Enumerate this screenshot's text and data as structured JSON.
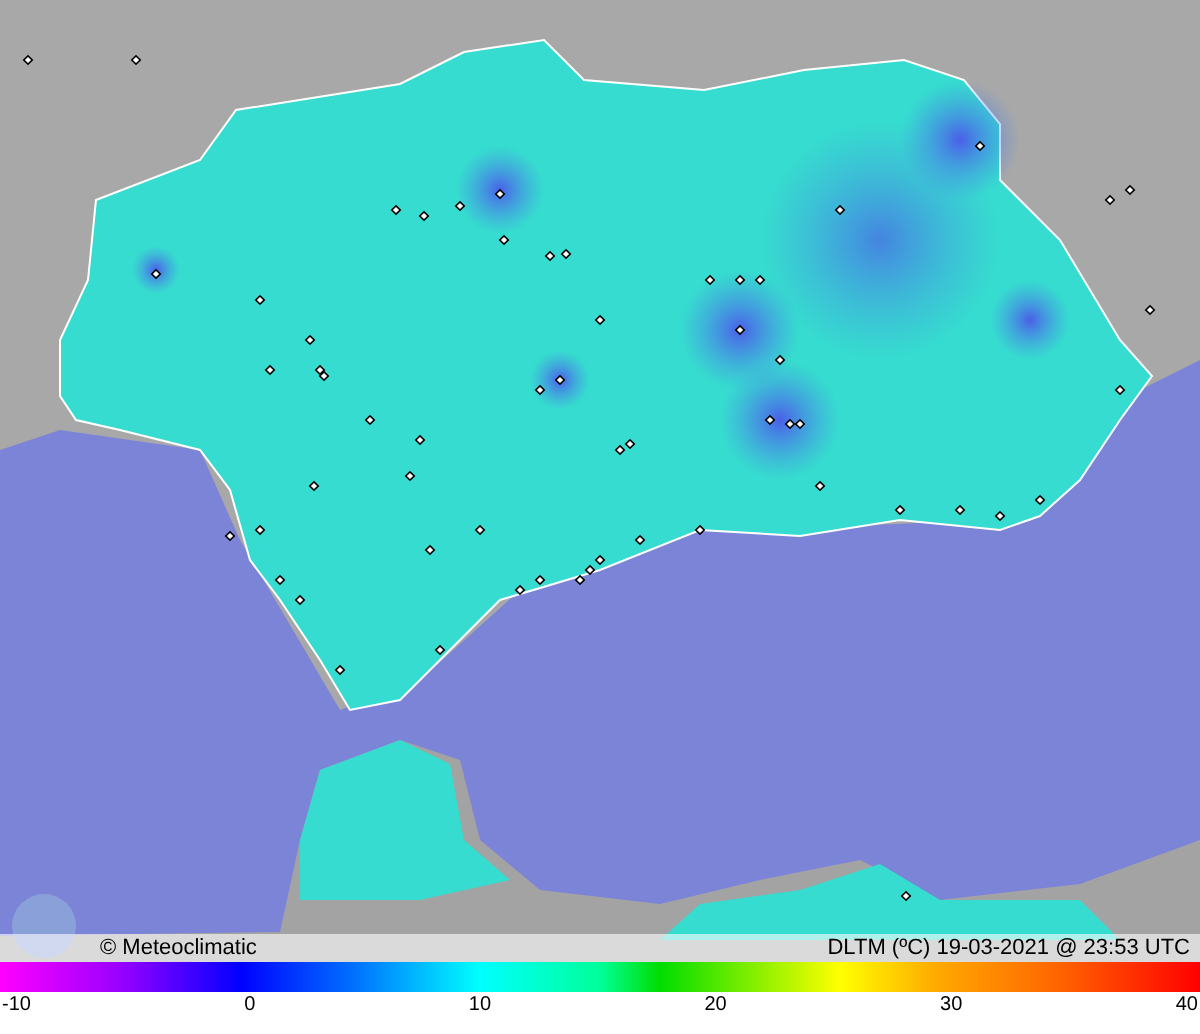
{
  "map": {
    "brand": "© Meteoclimatic",
    "caption": "DLTM (ºC) 19-03-2021 @ 23:53 UTC"
  },
  "color_scale": {
    "labels": [
      "-10",
      "0",
      "10",
      "20",
      "30",
      "40"
    ]
  }
}
